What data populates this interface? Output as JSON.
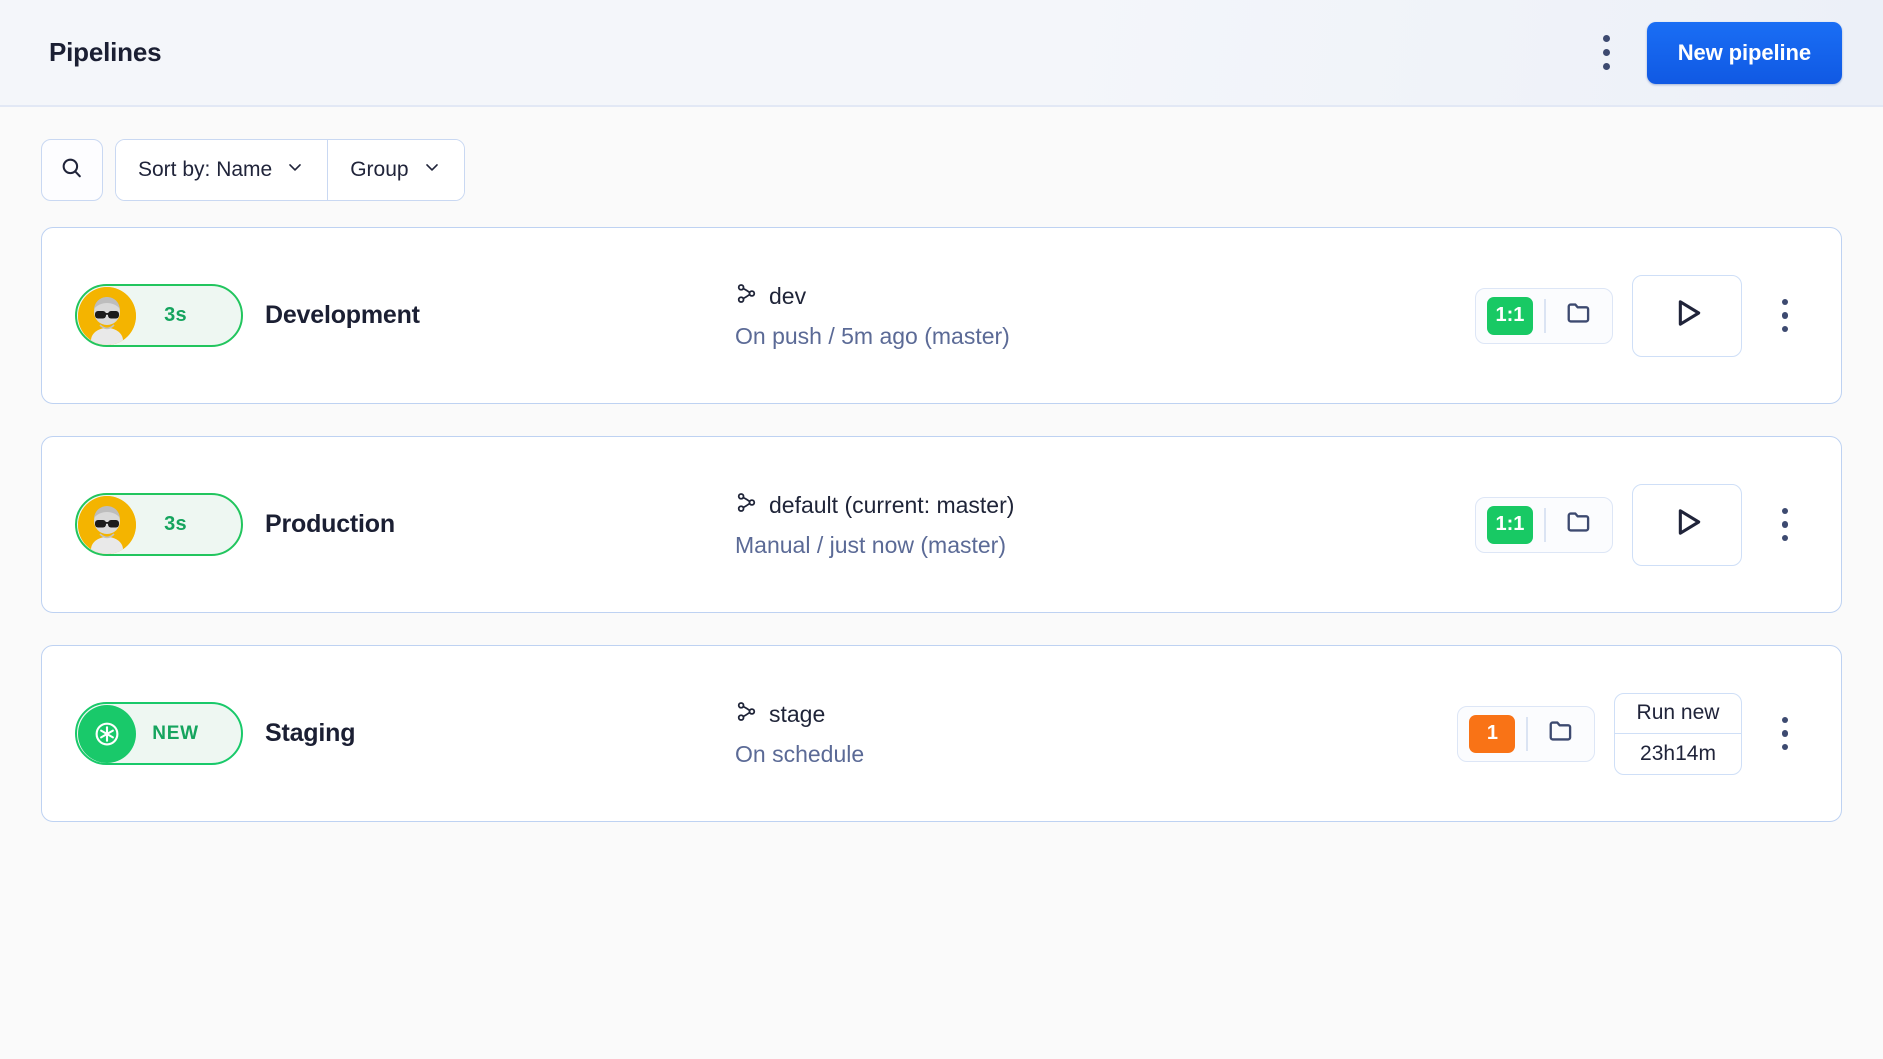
{
  "header": {
    "title": "Pipelines",
    "menu_icon": "kebab-menu-icon",
    "new_pipeline_label": "New pipeline"
  },
  "toolbar": {
    "search_icon": "search-icon",
    "sort_label": "Sort by: Name",
    "group_label": "Group",
    "chevron_icon": "chevron-down-icon"
  },
  "pipelines": [
    {
      "status_label": "3s",
      "status_type": "avatar",
      "status_color": "#22c55e",
      "name": "Development",
      "branch_icon": "git-branch-icon",
      "branch": "dev",
      "trigger": "On push / 5m ago (master)",
      "count": "1:1",
      "count_color": "#18c964",
      "folder_icon": "folder-icon",
      "action_icon": "play-icon",
      "action_type": "play",
      "menu_icon": "kebab-menu-icon"
    },
    {
      "status_label": "3s",
      "status_type": "avatar",
      "status_color": "#22c55e",
      "name": "Production",
      "branch_icon": "git-branch-icon",
      "branch": "default (current: master)",
      "trigger": "Manual / just now (master)",
      "count": "1:1",
      "count_color": "#18c964",
      "folder_icon": "folder-icon",
      "action_icon": "play-icon",
      "action_type": "play",
      "menu_icon": "kebab-menu-icon"
    },
    {
      "status_label": "NEW",
      "status_type": "dot",
      "status_color": "#19c96a",
      "name": "Staging",
      "branch_icon": "git-branch-icon",
      "branch": "stage",
      "trigger": "On schedule",
      "count": "1",
      "count_color": "#f97316",
      "folder_icon": "folder-icon",
      "action_type": "text",
      "action_line1": "Run new",
      "action_line2": "23h14m",
      "menu_icon": "kebab-menu-icon"
    }
  ]
}
